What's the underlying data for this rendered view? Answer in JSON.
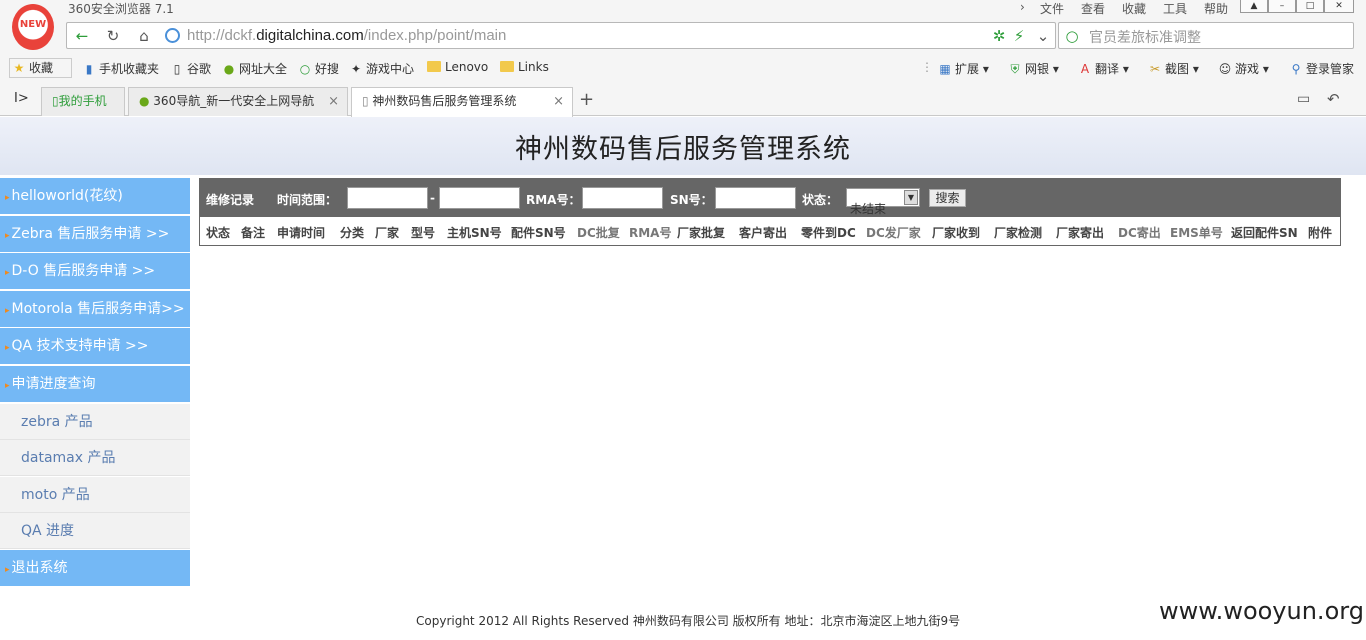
{
  "browser": {
    "title": "360安全浏览器 7.1",
    "logo_text": "NEW",
    "menu": [
      "文件",
      "查看",
      "收藏",
      "工具",
      "帮助"
    ],
    "url_prefix": "http://dckf.",
    "url_domain": "digitalchina.com",
    "url_path": "/index.php/point/main",
    "search_placeholder": "官员差旅标准调整",
    "favorites": [
      "收藏",
      "手机收藏夹",
      "谷歌",
      "网址大全",
      "好搜",
      "游戏中心",
      "Lenovo",
      "Links"
    ],
    "tools": [
      "扩展",
      "网银",
      "翻译",
      "截图",
      "游戏",
      "登录管家"
    ],
    "tabs": [
      {
        "label": "我的手机",
        "active": false
      },
      {
        "label": "360导航_新一代安全上网导航",
        "active": false
      },
      {
        "label": "神州数码售后服务管理系统",
        "active": true
      }
    ]
  },
  "page": {
    "title": "神州数码售后服务管理系统",
    "sidebar": [
      {
        "label": "helloworld(花纹)",
        "type": "blue"
      },
      {
        "label": "Zebra 售后服务申请 >>",
        "type": "blue"
      },
      {
        "label": "D-O 售后服务申请 >>",
        "type": "blue"
      },
      {
        "label": "Motorola 售后服务申请>>",
        "type": "blue"
      },
      {
        "label": "QA 技术支持申请 >>",
        "type": "blue"
      },
      {
        "label": "申请进度查询",
        "type": "blue"
      },
      {
        "label": "zebra 产品",
        "type": "sub"
      },
      {
        "label": "datamax 产品",
        "type": "sub"
      },
      {
        "label": "moto 产品",
        "type": "sub"
      },
      {
        "label": "QA 进度",
        "type": "sub"
      },
      {
        "label": "退出系统",
        "type": "blue"
      }
    ],
    "filter": {
      "section": "维修记录",
      "time_label": "时间范围：",
      "dash": "-",
      "rma_label": "RMA号：",
      "sn_label": "SN号：",
      "status_label": "状态：",
      "status_value": "未结束",
      "search_button": "搜索"
    },
    "columns": [
      "状态",
      "备注",
      "申请时间",
      "分类",
      "厂家",
      "型号",
      "主机SN号",
      "配件SN号",
      "DC批复",
      "RMA号",
      "厂家批复",
      "客户寄出",
      "零件到DC",
      "DC发厂家",
      "厂家收到",
      "厂家检测",
      "厂家寄出",
      "DC寄出",
      "EMS单号",
      "返回配件SN",
      "附件"
    ],
    "footer": "Copyright 2012 All Rights Reserved 神州数码有限公司 版权所有 地址：北京市海淀区上地九街9号",
    "watermark": "www.wooyun.org"
  }
}
